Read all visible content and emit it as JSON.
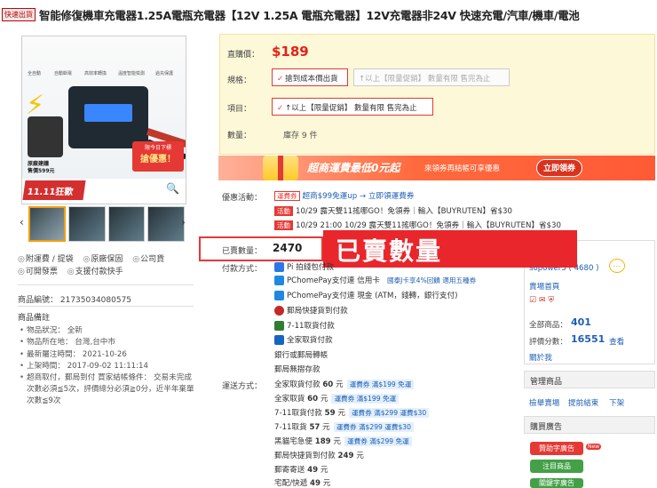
{
  "header": {
    "fast_tag": "快速出貨",
    "title": "智能修復機車充電器1.25A電瓶充電器【12V 1.25A 電瓶充電器】12V充電器非24V 快速充電/汽車/機車/電池"
  },
  "gallery": {
    "chip_labels": [
      "全自動",
      "自動斷電",
      "高效率轉換",
      "溫度智能檢測",
      "過充保護"
    ],
    "promo_line1": "限今日下標",
    "promo_line2": "搶優惠！",
    "original_line1": "原廠建議",
    "original_line2": "售價599元",
    "sale_badge": "11.11狂歡節",
    "zoom_icon": "magnifier-icon",
    "next_arrow": "›",
    "prev_arrow": "‹"
  },
  "left_links": [
    {
      "icon": "◎",
      "label": "附運費 / 提袋"
    },
    {
      "icon": "◎",
      "label": "原廠保固"
    },
    {
      "icon": "◎",
      "label": "公司貨"
    },
    {
      "icon": "◎",
      "label": "可開發票"
    },
    {
      "icon": "◎",
      "label": "支援付款快手"
    }
  ],
  "product_no": "商品編號： 21735034080575",
  "notes": {
    "title": "商品備註",
    "items": [
      "物品狀況： 全新",
      "物品所在地： 台灣,台中市",
      "最新屬注時間： 2021-10-26",
      "上架時間： 2017-09-02 11:11:14",
      "超商取付，郵局到付 買家結帳條件： 交易未完成次數必須≦5次，評價總分必須≧0分，近半年棄單次數≦9次"
    ]
  },
  "purchase": {
    "price_label": "直購價：",
    "price": "$189",
    "spec_label": "規格：",
    "spec_options": [
      {
        "label": "搶到成本價出貨",
        "state": "active"
      },
      {
        "label": "↑以上【限量促銷】 數量有限 售完為止",
        "state": "disabled"
      }
    ],
    "item_label": "項目：",
    "item_option": "↑以上【限量促銷】 數量有限 售完為止",
    "qty_label": "數量：",
    "stock": "庫存 9 件"
  },
  "banner": {
    "main": "超商運費最低0元起",
    "sub": "來領券再結帳可享優惠",
    "button": "立即領券"
  },
  "promotions": {
    "label": "優惠活動：",
    "lines": [
      {
        "pill": "運費券",
        "text": "超商$99免運up → 立即領運費券"
      },
      {
        "pill": "活動",
        "text": "10/29 露天雙11搖哪GO！免領券｜輸入【BUYRUTEN】省$30"
      },
      {
        "pill": "活動",
        "text": "10/29 21:00 10/29 露天雙11搖哪GO！免領券｜輸入【BUYRUTEN】省$30"
      }
    ]
  },
  "sold": {
    "label": "已賣數量：",
    "value": "2470",
    "callout": "已賣數量"
  },
  "payment": {
    "label": "付款方式：",
    "methods": [
      {
        "label": "Pi 拍錢包付款",
        "color": "#2b78e4"
      },
      {
        "label": "PChomePay支付連 信用卡",
        "extra": "國泰J卡享4%回饋 適用五種券",
        "color": "#1e88e5"
      },
      {
        "label": "PChomePay支付連 現金 (ATM，錢轉，銀行支付)",
        "color": "#1e88e5"
      },
      {
        "label": "郵局快捷貨到付款",
        "color": "#c62828"
      },
      {
        "label": "7-11取貨付款",
        "color": "#2e7d32"
      },
      {
        "label": "全家取貨付款",
        "color": "#1565c0"
      },
      {
        "label": "銀行或郵局轉帳",
        "color": ""
      },
      {
        "label": "郵局無摺存款",
        "color": ""
      }
    ]
  },
  "shipping": {
    "label": "運送方式：",
    "rows": [
      {
        "name": "全家取貨付款",
        "price": "60",
        "unit": "元",
        "coupon": "運費券 滿$199 免運"
      },
      {
        "name": "全家取貨",
        "price": "60",
        "unit": "元",
        "coupon": "運費券 滿$199 免運"
      },
      {
        "name": "7-11取貨付款",
        "price": "59",
        "unit": "元",
        "coupon": "運費券 滿$299 運費$30"
      },
      {
        "name": "7-11取貨",
        "price": "57",
        "unit": "元",
        "coupon": "運費券 滿$299 運費$30"
      },
      {
        "name": "黑貓宅急便",
        "price": "189",
        "unit": "元",
        "coupon": "運費券 滿$299 免運"
      },
      {
        "name": "郵局快捷貨到付款",
        "price": "249",
        "unit": "元",
        "coupon": ""
      },
      {
        "name": "郵寄寄送",
        "price": "49",
        "unit": "元",
        "coupon": ""
      },
      {
        "name": "宅配/快遞",
        "price": "49",
        "unit": "元",
        "coupon": ""
      }
    ]
  },
  "seller": {
    "name": "sopower3 ( 4680 )",
    "store_link": "賣場首頁",
    "total_label": "全部商品：",
    "total": "401",
    "rating_label": "評價分數：",
    "rating": "16551",
    "rating_link": "查看",
    "follow": "關於我"
  },
  "manage": {
    "title": "管理商品",
    "links": [
      "檢舉賣場",
      "提前結束",
      "下架"
    ]
  },
  "ads": {
    "title": "購買廣告",
    "buttons": [
      {
        "label": "贊助字廣告",
        "color": "#e53935"
      },
      {
        "label": "注目商品",
        "color": "#43a047"
      },
      {
        "label": "關鍵字廣告",
        "color": "#43a047"
      }
    ],
    "new_tag": "New"
  }
}
